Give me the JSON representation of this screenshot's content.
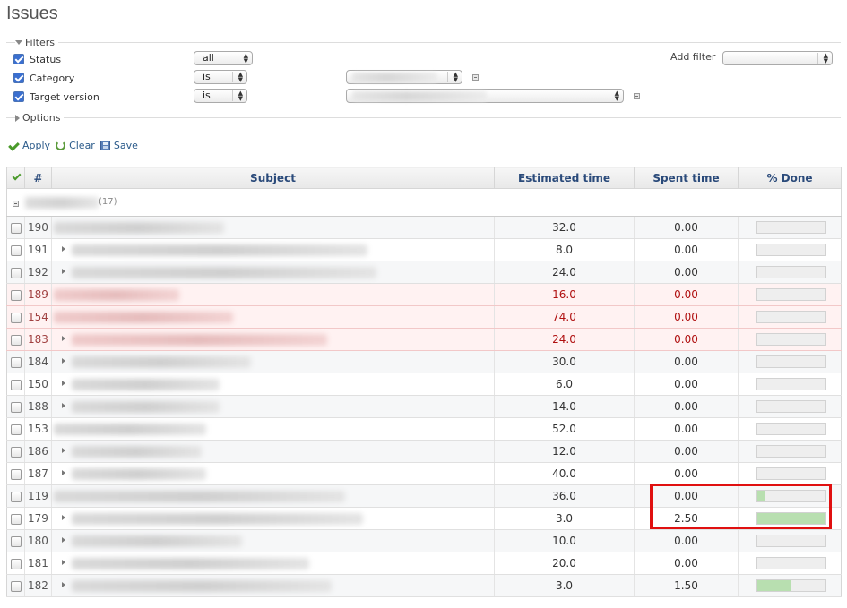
{
  "page": {
    "title": "Issues"
  },
  "filters": {
    "legend": "Filters",
    "add_filter_label": "Add filter",
    "add_filter_value": "",
    "rows": [
      {
        "label": "Status",
        "operator": "all"
      },
      {
        "label": "Category",
        "operator": "is"
      },
      {
        "label": "Target version",
        "operator": "is"
      }
    ]
  },
  "options": {
    "legend": "Options"
  },
  "actions": {
    "apply": "Apply",
    "clear": "Clear",
    "save": "Save"
  },
  "table": {
    "headers": {
      "id": "#",
      "subject": "Subject",
      "estimated": "Estimated time",
      "spent": "Spent time",
      "done": "% Done"
    },
    "group": {
      "count": "(17)"
    },
    "rows": [
      {
        "id": "190",
        "estimated": "32.0",
        "spent": "0.00",
        "done": 0,
        "overdue": false,
        "children": false
      },
      {
        "id": "191",
        "estimated": "8.0",
        "spent": "0.00",
        "done": 0,
        "overdue": false,
        "children": true
      },
      {
        "id": "192",
        "estimated": "24.0",
        "spent": "0.00",
        "done": 0,
        "overdue": false,
        "children": true
      },
      {
        "id": "189",
        "estimated": "16.0",
        "spent": "0.00",
        "done": 0,
        "overdue": true,
        "children": false
      },
      {
        "id": "154",
        "estimated": "74.0",
        "spent": "0.00",
        "done": 0,
        "overdue": true,
        "children": false
      },
      {
        "id": "183",
        "estimated": "24.0",
        "spent": "0.00",
        "done": 0,
        "overdue": true,
        "children": true
      },
      {
        "id": "184",
        "estimated": "30.0",
        "spent": "0.00",
        "done": 0,
        "overdue": false,
        "children": true
      },
      {
        "id": "150",
        "estimated": "6.0",
        "spent": "0.00",
        "done": 0,
        "overdue": false,
        "children": true
      },
      {
        "id": "188",
        "estimated": "14.0",
        "spent": "0.00",
        "done": 0,
        "overdue": false,
        "children": true
      },
      {
        "id": "153",
        "estimated": "52.0",
        "spent": "0.00",
        "done": 0,
        "overdue": false,
        "children": false
      },
      {
        "id": "186",
        "estimated": "12.0",
        "spent": "0.00",
        "done": 0,
        "overdue": false,
        "children": true
      },
      {
        "id": "187",
        "estimated": "40.0",
        "spent": "0.00",
        "done": 0,
        "overdue": false,
        "children": true
      },
      {
        "id": "119",
        "estimated": "36.0",
        "spent": "0.00",
        "done": 10,
        "overdue": false,
        "children": false
      },
      {
        "id": "179",
        "estimated": "3.0",
        "spent": "2.50",
        "done": 100,
        "overdue": false,
        "children": true
      },
      {
        "id": "180",
        "estimated": "10.0",
        "spent": "0.00",
        "done": 0,
        "overdue": false,
        "children": true
      },
      {
        "id": "181",
        "estimated": "20.0",
        "spent": "0.00",
        "done": 0,
        "overdue": false,
        "children": true
      },
      {
        "id": "182",
        "estimated": "3.0",
        "spent": "1.50",
        "done": 50,
        "overdue": false,
        "children": true
      }
    ]
  },
  "colors": {
    "link": "#2a5a8a",
    "overdue_text": "#b01010",
    "overdue_bg": "#fff2f2",
    "progress_fill": "#b8dfb0",
    "highlight": "#e01010"
  }
}
